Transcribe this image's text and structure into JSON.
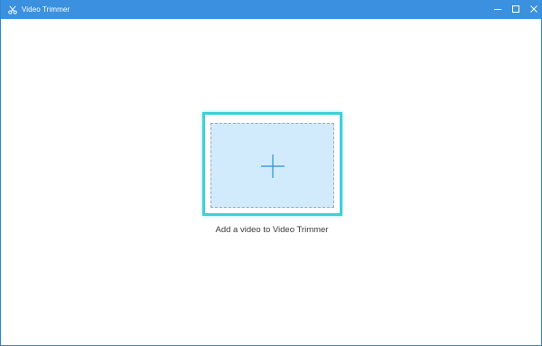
{
  "window": {
    "title": "Video Trimmer",
    "app_icon": "scissors-icon",
    "controls": {
      "minimize": "minimize-icon",
      "maximize": "maximize-icon",
      "close": "close-icon"
    }
  },
  "main": {
    "drop_caption": "Add a video to Video Trimmer",
    "add_icon": "plus-icon"
  },
  "colors": {
    "titlebar": "#3b91e0",
    "drop_highlight": "#3ed0d8",
    "drop_fill": "#d1ebfd",
    "plus": "#2a8fd6"
  }
}
